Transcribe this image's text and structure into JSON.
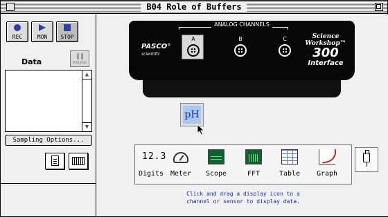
{
  "window": {
    "title": "B04 Role of Buffers"
  },
  "controls": {
    "rec_label": "REC",
    "mon_label": "MON",
    "stop_label": "STOP",
    "pause_label": "PAUSE"
  },
  "data_panel": {
    "label": "Data"
  },
  "buttons": {
    "sampling_options": "Sampling Options..."
  },
  "interface": {
    "analog_channels_label": "ANALOG CHANNELS",
    "brand": "PASCO°",
    "brand_sub": "scientific",
    "channel_a": "A",
    "channel_b": "B",
    "channel_c": "C",
    "logo_line1": "Science",
    "logo_line2": "Workshop™",
    "logo_model": "300",
    "logo_line4": "Interface"
  },
  "sensor": {
    "label": "pH"
  },
  "displays": {
    "items": [
      {
        "label": "Digits",
        "icon": "digits-icon",
        "glyph": "12.3"
      },
      {
        "label": "Meter",
        "icon": "meter-icon"
      },
      {
        "label": "Scope",
        "icon": "scope-icon"
      },
      {
        "label": "FFT",
        "icon": "fft-icon"
      },
      {
        "label": "Table",
        "icon": "table-icon"
      },
      {
        "label": "Graph",
        "icon": "graph-icon"
      }
    ],
    "hint_line1": "Click and drag a display icon to a",
    "hint_line2": "channel or sensor to display data."
  },
  "colors": {
    "accent_blue": "#2b3fa0",
    "scope_green": "#135f34",
    "trace_green": "#5ef06e",
    "sensor_blue": "#a9c8f0",
    "graph_red": "#c02020"
  }
}
